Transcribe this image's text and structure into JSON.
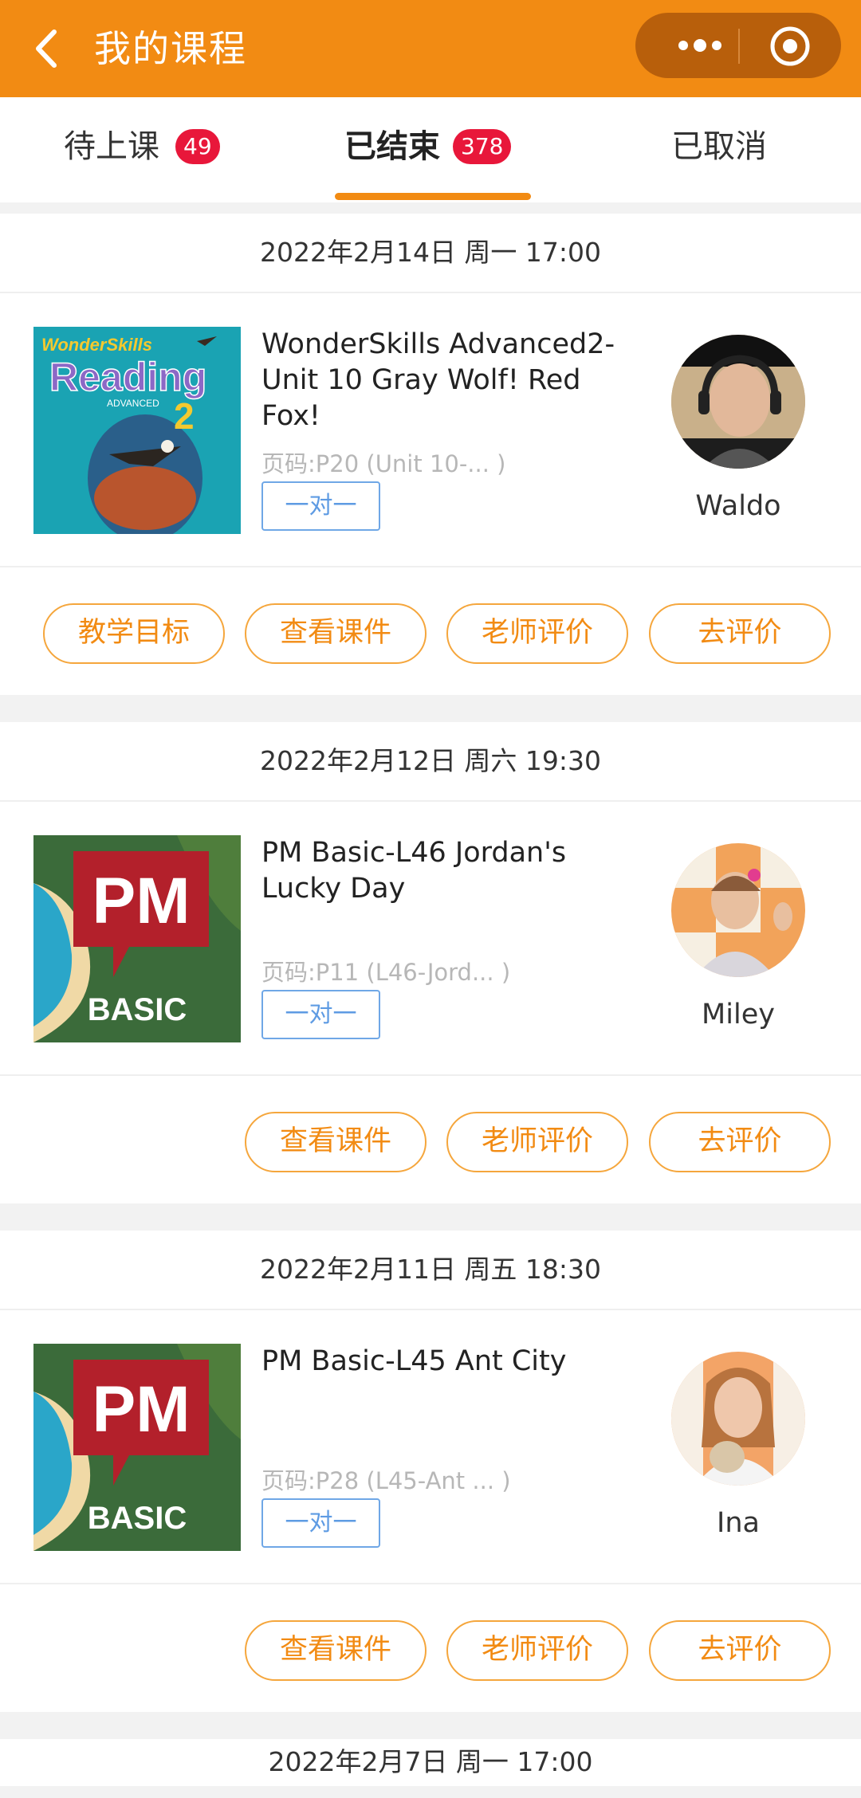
{
  "nav": {
    "title": "我的课程",
    "back_icon": "chevron-left-icon",
    "menu_icon": "more-dots-icon",
    "close_icon": "target-circle-icon",
    "bar_color": "#f28b13"
  },
  "tabs": [
    {
      "label": "待上课",
      "count": "49",
      "active": false
    },
    {
      "label": "已结束",
      "count": "378",
      "active": true
    },
    {
      "label": "已取消",
      "active": false
    }
  ],
  "lessons": [
    {
      "datetime": "2022年2月14日 周一 17:00",
      "cover": {
        "brand": "WonderSkills",
        "title": "Reading",
        "level": "ADVANCED",
        "number": "2"
      },
      "title": "WonderSkills Advanced2-Unit 10 Gray Wolf! Red Fox!",
      "page_code": "页码:P20 (Unit 10-... )",
      "type": "一对一",
      "teacher": "Waldo",
      "actions": [
        "教学目标",
        "查看课件",
        "老师评价",
        "去评价"
      ]
    },
    {
      "datetime": "2022年2月12日 周六 19:30",
      "cover": {
        "brand": "PM",
        "title": "BASIC"
      },
      "title": "PM Basic-L46 Jordan's Lucky Day",
      "page_code": "页码:P11 (L46-Jord... )",
      "type": "一对一",
      "teacher": "Miley",
      "actions": [
        "查看课件",
        "老师评价",
        "去评价"
      ]
    },
    {
      "datetime": "2022年2月11日 周五 18:30",
      "cover": {
        "brand": "PM",
        "title": "BASIC"
      },
      "title": "PM Basic-L45 Ant City",
      "page_code": "页码:P28 (L45-Ant ... )",
      "type": "一对一",
      "teacher": "Ina",
      "actions": [
        "查看课件",
        "老师评价",
        "去评价"
      ]
    },
    {
      "datetime": "2022年2月7日 周一 17:00"
    }
  ]
}
